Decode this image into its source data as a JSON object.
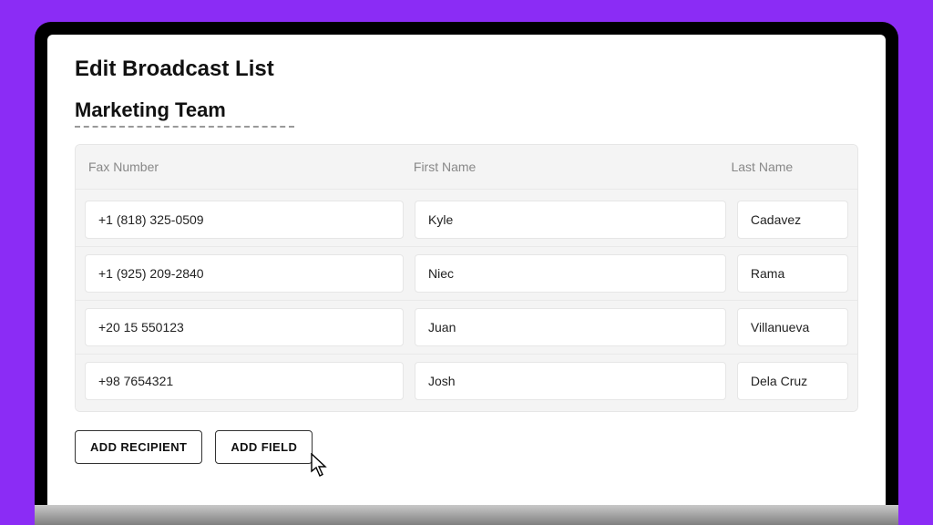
{
  "page_title": "Edit Broadcast List",
  "list_name": "Marketing Team",
  "columns": {
    "fax": "Fax Number",
    "first": "First Name",
    "last": "Last Name"
  },
  "rows": [
    {
      "fax": "+1 (818) 325-0509",
      "first": "Kyle",
      "last": "Cadavez"
    },
    {
      "fax": "+1 (925) 209-2840",
      "first": "Niec",
      "last": "Rama"
    },
    {
      "fax": "+20 15 550123",
      "first": "Juan",
      "last": "Villanueva"
    },
    {
      "fax": "+98 7654321",
      "first": "Josh",
      "last": "Dela Cruz"
    }
  ],
  "buttons": {
    "add_recipient": "ADD RECIPIENT",
    "add_field": "ADD FIELD"
  }
}
